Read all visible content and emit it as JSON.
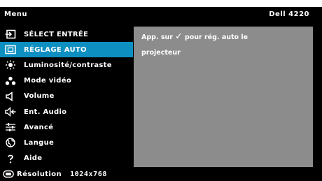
{
  "header": {
    "title": "Menu",
    "model": "Dell 4220"
  },
  "menu": {
    "items": [
      {
        "label": "SÉLECT ENTRÉE",
        "icon": "input-source-icon",
        "selected": false
      },
      {
        "label": "RÉGLAGE AUTO",
        "icon": "auto-adjust-icon",
        "selected": true
      },
      {
        "label": "Luminosité/contraste",
        "icon": "brightness-icon",
        "selected": false
      },
      {
        "label": "Mode vidéo",
        "icon": "video-mode-icon",
        "selected": false
      },
      {
        "label": "Volume",
        "icon": "speaker-icon",
        "selected": false
      },
      {
        "label": "Ent. Audio",
        "icon": "audio-input-icon",
        "selected": false
      },
      {
        "label": "Avancé",
        "icon": "advanced-settings-icon",
        "selected": false
      },
      {
        "label": "Langue",
        "icon": "globe-icon",
        "selected": false
      },
      {
        "label": "Aide",
        "icon": "help-icon",
        "selected": false
      }
    ]
  },
  "panel": {
    "line1_before": "App. sur",
    "check": "✓",
    "line1_after": "pour rég. auto le",
    "line2": "projecteur"
  },
  "status": {
    "label": "Résolution",
    "value": "1024x768"
  },
  "colors": {
    "background": "#000000",
    "selected": "#0d8fc2",
    "panel": "#8c8c8c",
    "text": "#ffffff"
  }
}
